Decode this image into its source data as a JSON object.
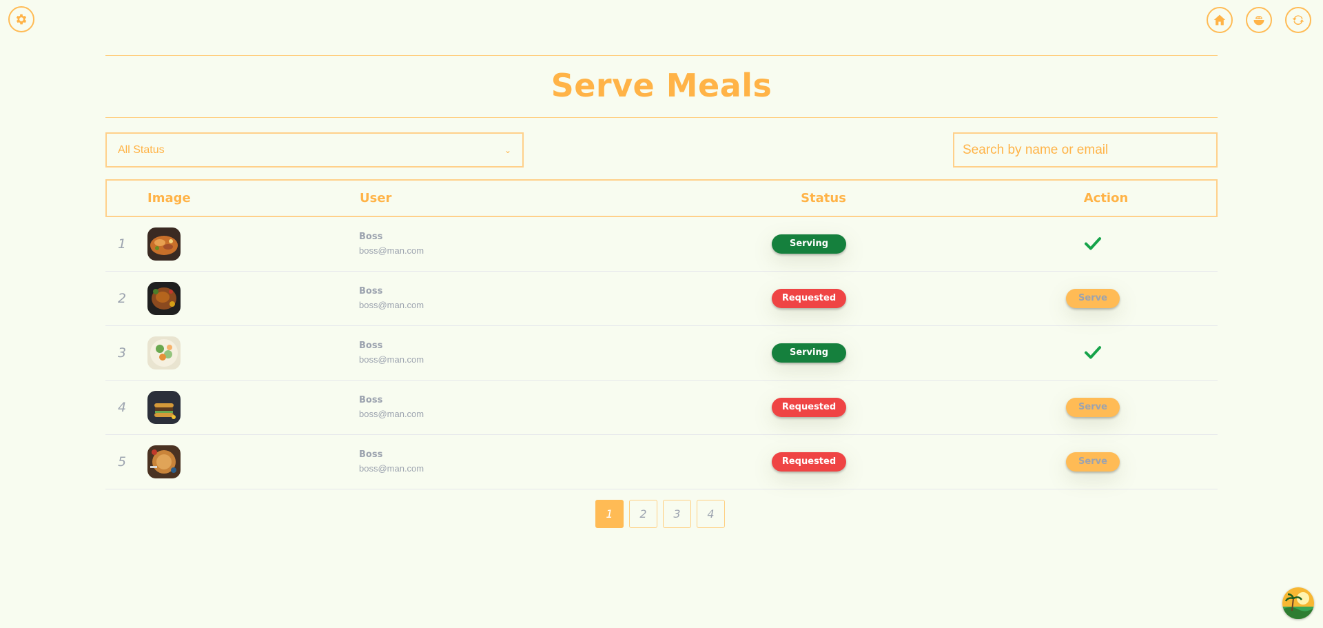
{
  "header": {
    "title": "Serve Meals",
    "icons": [
      "gear-icon",
      "home-icon",
      "meal-bowl-icon",
      "refresh-icon"
    ]
  },
  "filters": {
    "status_select": {
      "value": "All Status"
    },
    "search": {
      "placeholder": "Search by name or email",
      "value": ""
    }
  },
  "table": {
    "columns": {
      "image": "Image",
      "user": "User",
      "status": "Status",
      "action": "Action"
    },
    "rows": [
      {
        "num": "1",
        "name": "Boss",
        "email": "boss@man.com",
        "status": "Serving",
        "action": "check-icon"
      },
      {
        "num": "2",
        "name": "Boss",
        "email": "boss@man.com",
        "status": "Requested",
        "action": "Serve"
      },
      {
        "num": "3",
        "name": "Boss",
        "email": "boss@man.com",
        "status": "Serving",
        "action": "check-icon"
      },
      {
        "num": "4",
        "name": "Boss",
        "email": "boss@man.com",
        "status": "Requested",
        "action": "Serve"
      },
      {
        "num": "5",
        "name": "Boss",
        "email": "boss@man.com",
        "status": "Requested",
        "action": "Serve"
      }
    ]
  },
  "pagination": {
    "pages": [
      "1",
      "2",
      "3",
      "4"
    ],
    "current": "1"
  },
  "colors": {
    "accent": "#ffb347",
    "background": "#f8fcf0",
    "serving": "#15803d",
    "requested": "#ef4444",
    "serve_button": "#ffbb55"
  }
}
